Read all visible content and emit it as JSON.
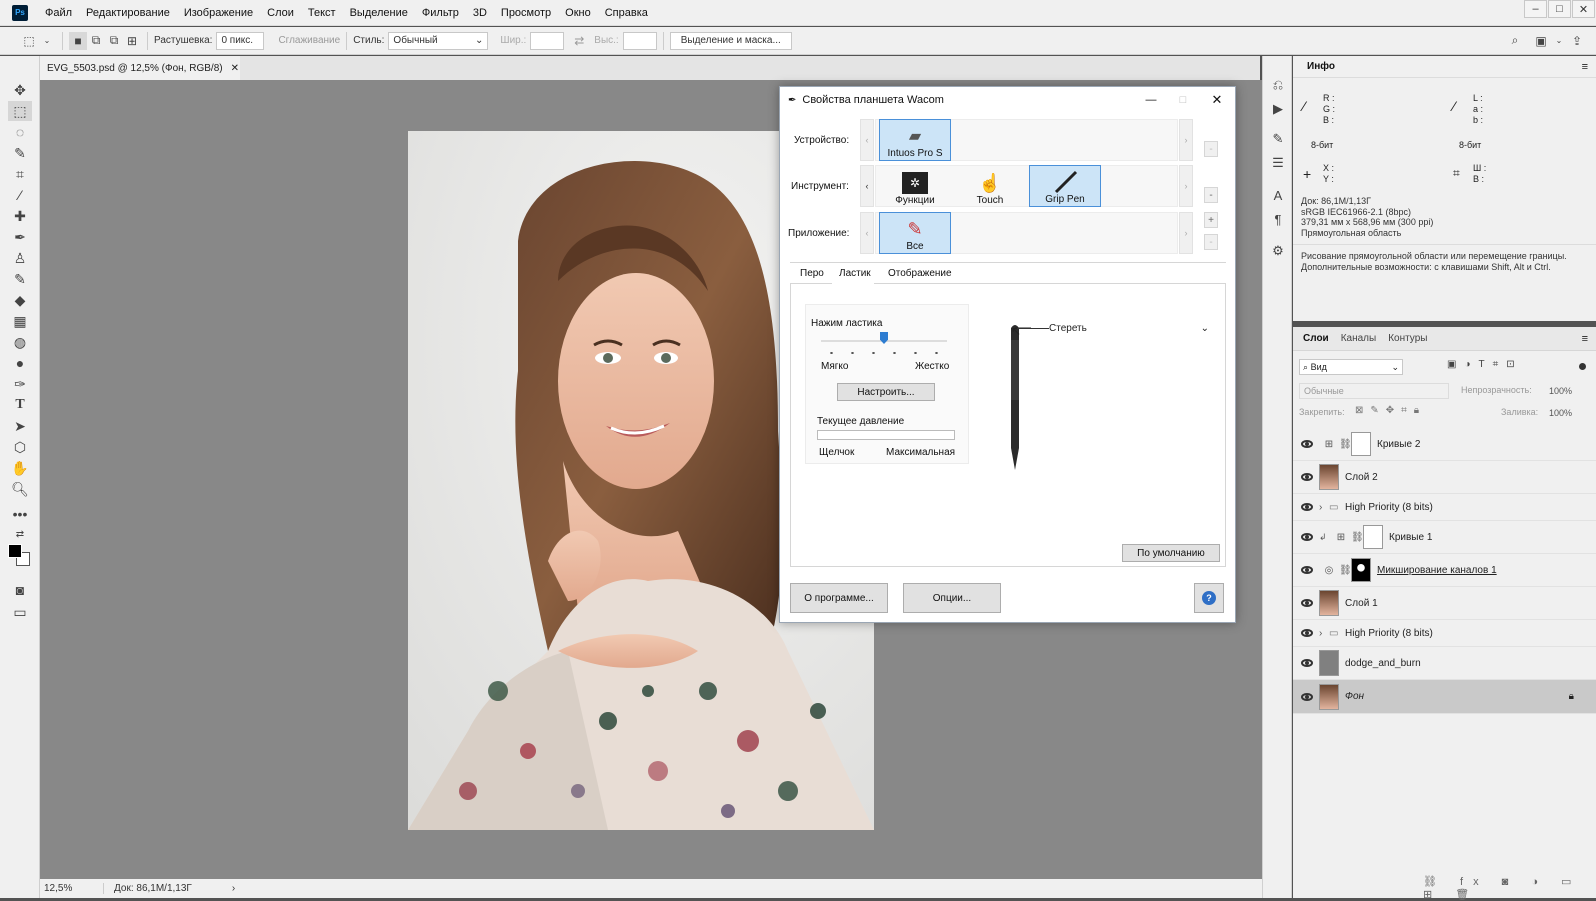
{
  "menubar": {
    "items": [
      "Файл",
      "Редактирование",
      "Изображение",
      "Слои",
      "Текст",
      "Выделение",
      "Фильтр",
      "3D",
      "Просмотр",
      "Окно",
      "Справка"
    ],
    "logo": "Ps"
  },
  "options": {
    "feather_label": "Растушевка:",
    "feather_value": "0 пикс.",
    "antialias_label": "Сглаживание",
    "style_label": "Стиль:",
    "style_value": "Обычный",
    "width_label": "Шир.:",
    "height_label": "Выс.:",
    "select_mask_label": "Выделение и маска..."
  },
  "document": {
    "tab_title": "EVG_5503.psd @ 12,5% (Фон, RGB/8)",
    "zoom": "12,5%",
    "doc_info": "Док: 86,1M/1,13Г"
  },
  "info": {
    "title": "Инфо",
    "rgb_r": "R :",
    "rgb_g": "G :",
    "rgb_b": "B :",
    "lab_l": "L :",
    "lab_a": "a :",
    "lab_b": "b :",
    "bit1": "8-бит",
    "bit2": "8-бит",
    "x": "X :",
    "y": "Y :",
    "w": "Ш :",
    "h": "В :",
    "doc_line": "Док: 86,1M/1,13Г",
    "profile_line": "sRGB IEC61966-2.1 (8bpc)",
    "size_line": "379,31 мм x 568,96 мм (300 ppi)",
    "tool_line": "Прямоугольная область",
    "hint": "Рисование прямоугольной области или перемещение границы. Дополнительные возможности: с клавишами Shift, Alt и Ctrl."
  },
  "layers": {
    "tabs": [
      "Слои",
      "Каналы",
      "Контуры"
    ],
    "filter_label": "Вид",
    "blend_mode": "Обычные",
    "opacity_label": "Непрозрачность:",
    "opacity_value": "100%",
    "lock_label": "Закрепить:",
    "fill_label": "Заливка:",
    "fill_value": "100%",
    "rows": [
      {
        "name": "Кривые 2"
      },
      {
        "name": "Слой 2"
      },
      {
        "name": "High Priority (8 bits)"
      },
      {
        "name": "Кривые 1"
      },
      {
        "name": "Микширование каналов 1"
      },
      {
        "name": "Слой 1"
      },
      {
        "name": "High Priority (8 bits)"
      },
      {
        "name": "dodge_and_burn"
      },
      {
        "name": "Фон"
      }
    ]
  },
  "dialog": {
    "title": "Свойства планшета Wacom",
    "device_label": "Устройство:",
    "device_tile": "Intuos Pro S",
    "tool_label": "Инструмент:",
    "tool_tiles": [
      "Функции",
      "Touch",
      "Grip Pen"
    ],
    "app_label": "Приложение:",
    "app_tile": "Все",
    "tabs": [
      "Перо",
      "Ластик",
      "Отображение"
    ],
    "eraser_feel_label": "Нажим ластика",
    "soft_label": "Мягко",
    "firm_label": "Жестко",
    "customize_button": "Настроить...",
    "current_pressure_label": "Текущее давление",
    "click_label": "Щелчок",
    "max_label": "Максимальная",
    "eraser_action": "Стереть",
    "default_button": "По умолчанию",
    "about_button": "О программе...",
    "options_button": "Опции...",
    "help_icon": "?",
    "eraser_feel_position": 0.5
  }
}
